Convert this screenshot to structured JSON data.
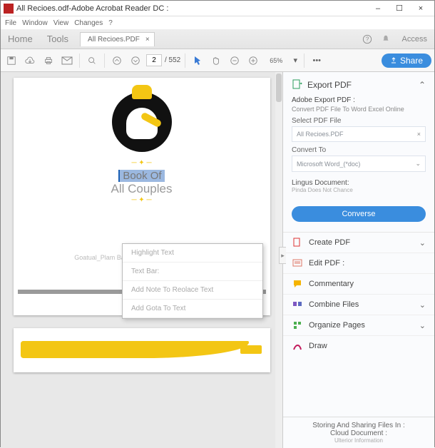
{
  "window": {
    "title": "All Recioes.odf-Adobe Acrobat Reader DC :",
    "minimize": "–",
    "maximize": "☐",
    "close": "×"
  },
  "menu": {
    "file": "File",
    "window": "Window",
    "view": "View",
    "changes": "Changes",
    "help": "?"
  },
  "tabs": {
    "home": "Home",
    "tools": "Tools",
    "doc": "All Recioes.PDF",
    "access": "Access"
  },
  "toolbar": {
    "page_current": "2",
    "page_total": "/ 552",
    "zoom": "65%",
    "share": "Share"
  },
  "document": {
    "selected_text": "Book Of",
    "subtitle": "All Couples",
    "footer": "Goatual_Plam Based On Raspadora Bella Idea"
  },
  "context": {
    "i0": "Highlight Text",
    "i1": "Text Bar:",
    "i2": "Add Note To Reolace Text",
    "i3": "Add Gota To Text"
  },
  "side": {
    "export": {
      "title": "Export PDF",
      "brand": "Adobe Export PDF :",
      "tagline": "Convert PDF File To Word Excel Online",
      "select_label": "Select PDF File",
      "file": "All Recioes.PDF",
      "convert_label": "Convert To",
      "target": "Microsoft Word_(*doc)",
      "lingua": "Lingus Document:",
      "lingua_sub": "Pinda Does Not Chance",
      "button": "Converse"
    },
    "tools": {
      "create": "Create PDF",
      "edit": "Edit PDF :",
      "commentary": "Commentary",
      "combine": "Combine Files",
      "organize": "Organize Pages",
      "draw": "Draw"
    },
    "footer": {
      "line1": "Storing And Sharing Files In :",
      "line2": "Cloud Document :",
      "line3": "Ulterior Information"
    }
  }
}
